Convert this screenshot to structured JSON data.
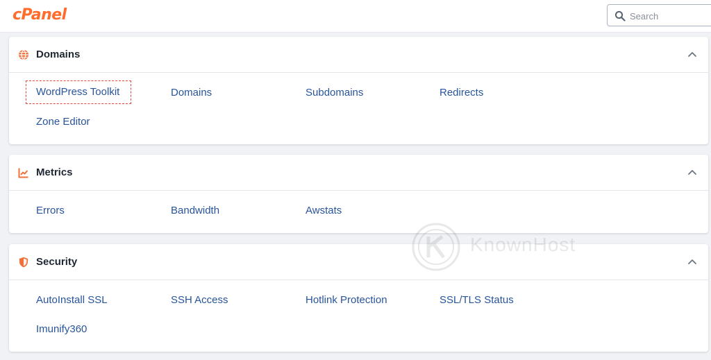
{
  "header": {
    "logo_text": "cPanel",
    "logo_color": "#ff6c2c",
    "search": {
      "placeholder": "Search",
      "value": ""
    }
  },
  "colors": {
    "link": "#28549c",
    "accent_icon": "#f0703a",
    "selection_outline": "#e0443a"
  },
  "sections": [
    {
      "title": "Domains",
      "icon": "globe-icon",
      "expanded": true,
      "items": [
        "WordPress Toolkit",
        "Domains",
        "Subdomains",
        "Redirects",
        "Zone Editor"
      ],
      "selected_item": "WordPress Toolkit"
    },
    {
      "title": "Metrics",
      "icon": "chart-line-icon",
      "expanded": true,
      "items": [
        "Errors",
        "Bandwidth",
        "Awstats"
      ]
    },
    {
      "title": "Security",
      "icon": "shield-icon",
      "expanded": true,
      "items": [
        "AutoInstall SSL",
        "SSH Access",
        "Hotlink Protection",
        "SSL/TLS Status",
        "Imunify360"
      ]
    }
  ],
  "watermark": {
    "text": "KnownHost",
    "icon": "knownhost-logo-icon"
  }
}
